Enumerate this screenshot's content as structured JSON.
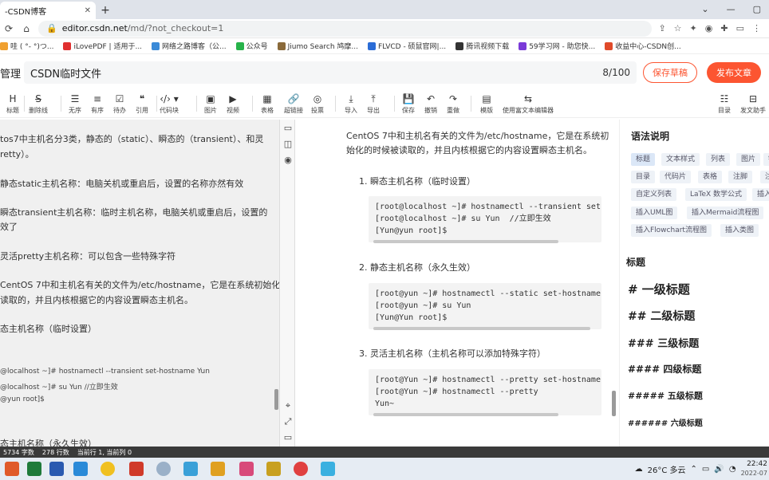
{
  "browser": {
    "tab_title": "-CSDN博客",
    "tab_close": "✕",
    "new_tab": "+",
    "window_controls": [
      "⌄",
      "—",
      "▢"
    ],
    "url_domain": "editor.csdn.net",
    "url_path": "/md/?not_checkout=1",
    "bookmarks": [
      {
        "label": "哇 ( °- °)つ...",
        "color": "#f0a030"
      },
      {
        "label": "iLovePDF | 适用于...",
        "color": "#e03030"
      },
      {
        "label": "网络之路博客（公...",
        "color": "#3a8ad8"
      },
      {
        "label": "公众号",
        "color": "#27b34a"
      },
      {
        "label": "Jiumo Search 鸠摩...",
        "color": "#8a6a3a"
      },
      {
        "label": "FLVCD - 硕鼠官网|...",
        "color": "#2b6cd6"
      },
      {
        "label": "腾讯视频下载",
        "color": "#333333"
      },
      {
        "label": "59学习网 - 助您快...",
        "color": "#7a3ad8"
      },
      {
        "label": "收益中心-CSDN创...",
        "color": "#e04a2a"
      }
    ]
  },
  "editor": {
    "manage_label": "管理",
    "title": "CSDN临时文件",
    "char_count": "8/100",
    "save_draft": "保存草稿",
    "publish": "发布文章"
  },
  "toolbar": [
    {
      "icon": "H",
      "label": "标题",
      "name": "heading"
    },
    {
      "icon": "S̶",
      "label": "删除线",
      "name": "strikethrough"
    },
    {
      "icon": "☰",
      "label": "无序",
      "name": "unordered-list"
    },
    {
      "icon": "≡",
      "label": "有序",
      "name": "ordered-list"
    },
    {
      "icon": "☑",
      "label": "待办",
      "name": "todo"
    },
    {
      "icon": "❝",
      "label": "引用",
      "name": "quote"
    },
    {
      "icon": "‹/› ▾",
      "label": "代码块",
      "name": "code-block"
    },
    {
      "icon": "▣",
      "label": "图片",
      "name": "image"
    },
    {
      "icon": "▶",
      "label": "视频",
      "name": "video"
    },
    {
      "icon": "▦",
      "label": "表格",
      "name": "table"
    },
    {
      "icon": "🔗",
      "label": "超链接",
      "name": "link"
    },
    {
      "icon": "◎",
      "label": "投票",
      "name": "vote"
    },
    {
      "icon": "⤓",
      "label": "导入",
      "name": "import"
    },
    {
      "icon": "⤒",
      "label": "导出",
      "name": "export"
    },
    {
      "icon": "💾",
      "label": "保存",
      "name": "save"
    },
    {
      "icon": "↶",
      "label": "撤销",
      "name": "undo"
    },
    {
      "icon": "↷",
      "label": "重做",
      "name": "redo"
    },
    {
      "icon": "▤",
      "label": "模版",
      "name": "template"
    },
    {
      "icon": "⇆",
      "label": "使用富文本编辑器",
      "name": "rich-text"
    },
    {
      "icon": "☷",
      "label": "目录",
      "name": "toc"
    },
    {
      "icon": "⊟",
      "label": "发文助手",
      "name": "assistant"
    }
  ],
  "left_pane": {
    "lines": [
      "tos7中主机名分3类，静态的（static）、瞬态的（transient）、和灵",
      "retty）。",
      "静态static主机名称：电脑关机或重启后，设置的名称亦然有效",
      "瞬态transient主机名称：临时主机名称，电脑关机或重启后，设置的",
      "效了",
      "灵活pretty主机名称：可以包含一些特殊字符",
      "CentOS 7中和主机名有关的文件为/etc/hostname，它是在系统初始化的",
      "读取的，并且内核根据它的内容设置瞬态主机名。",
      "态主机名称（临时设置）",
      "@localhost ~]# hostnamectl --transient set-hostname Yun",
      "@localhost ~]# su Yun   //立即生效",
      "@yun root]$",
      "态主机名称（永久生效）"
    ]
  },
  "preview": {
    "intro": "CentOS 7中和主机名有关的文件为/etc/hostname，它是在系统初始化的时候被读取的，并且内核根据它的内容设置瞬态主机名。",
    "sections": [
      {
        "heading": "1. 瞬态主机名称（临时设置）",
        "code": "[root@localhost ~]# hostnamectl --transient set-h\n[root@localhost ~]# su Yun  //立即生效\n[Yun@yun root]$"
      },
      {
        "heading": "2. 静态主机名称（永久生效）",
        "code": "[root@yun ~]# hostnamectl --static set-hostname Y\n[root@yun ~]# su Yun\n[Yun@Yun root]$"
      },
      {
        "heading": "3. 灵活主机名称（主机名称可以添加特殊字符）",
        "code": "[root@Yun ~]# hostnamectl --pretty set-hostname Y\n[root@Yun ~]# hostnamectl --pretty\nYun~"
      }
    ]
  },
  "syntax_panel": {
    "title": "语法说明",
    "chips": [
      {
        "label": "标题",
        "active": true
      },
      {
        "label": "文本样式"
      },
      {
        "label": "列表"
      },
      {
        "label": "图片"
      },
      {
        "label": "链"
      },
      {
        "label": "目录"
      },
      {
        "label": "代码片"
      },
      {
        "label": "表格"
      },
      {
        "label": "注脚"
      },
      {
        "label": "注"
      },
      {
        "label": "自定义列表"
      },
      {
        "label": "LaTeX 数学公式"
      },
      {
        "label": "插入"
      },
      {
        "label": "插入UML图"
      },
      {
        "label": "插入Mermaid流程图"
      },
      {
        "label": "插入Flowchart流程图"
      },
      {
        "label": "插入类图"
      }
    ],
    "headings_title": "标题",
    "headings": [
      "# 一级标题",
      "## 二级标题",
      "### 三级标题",
      "#### 四级标题",
      "##### 五级标题",
      "###### 六级标题"
    ]
  },
  "status_bar": {
    "words": "5734 字数",
    "lines": "278 行数",
    "cursor": "当前行 1, 当前列 0"
  },
  "taskbar": {
    "weather": "26°C 多云",
    "time": "22:42",
    "date": "2022-07"
  }
}
